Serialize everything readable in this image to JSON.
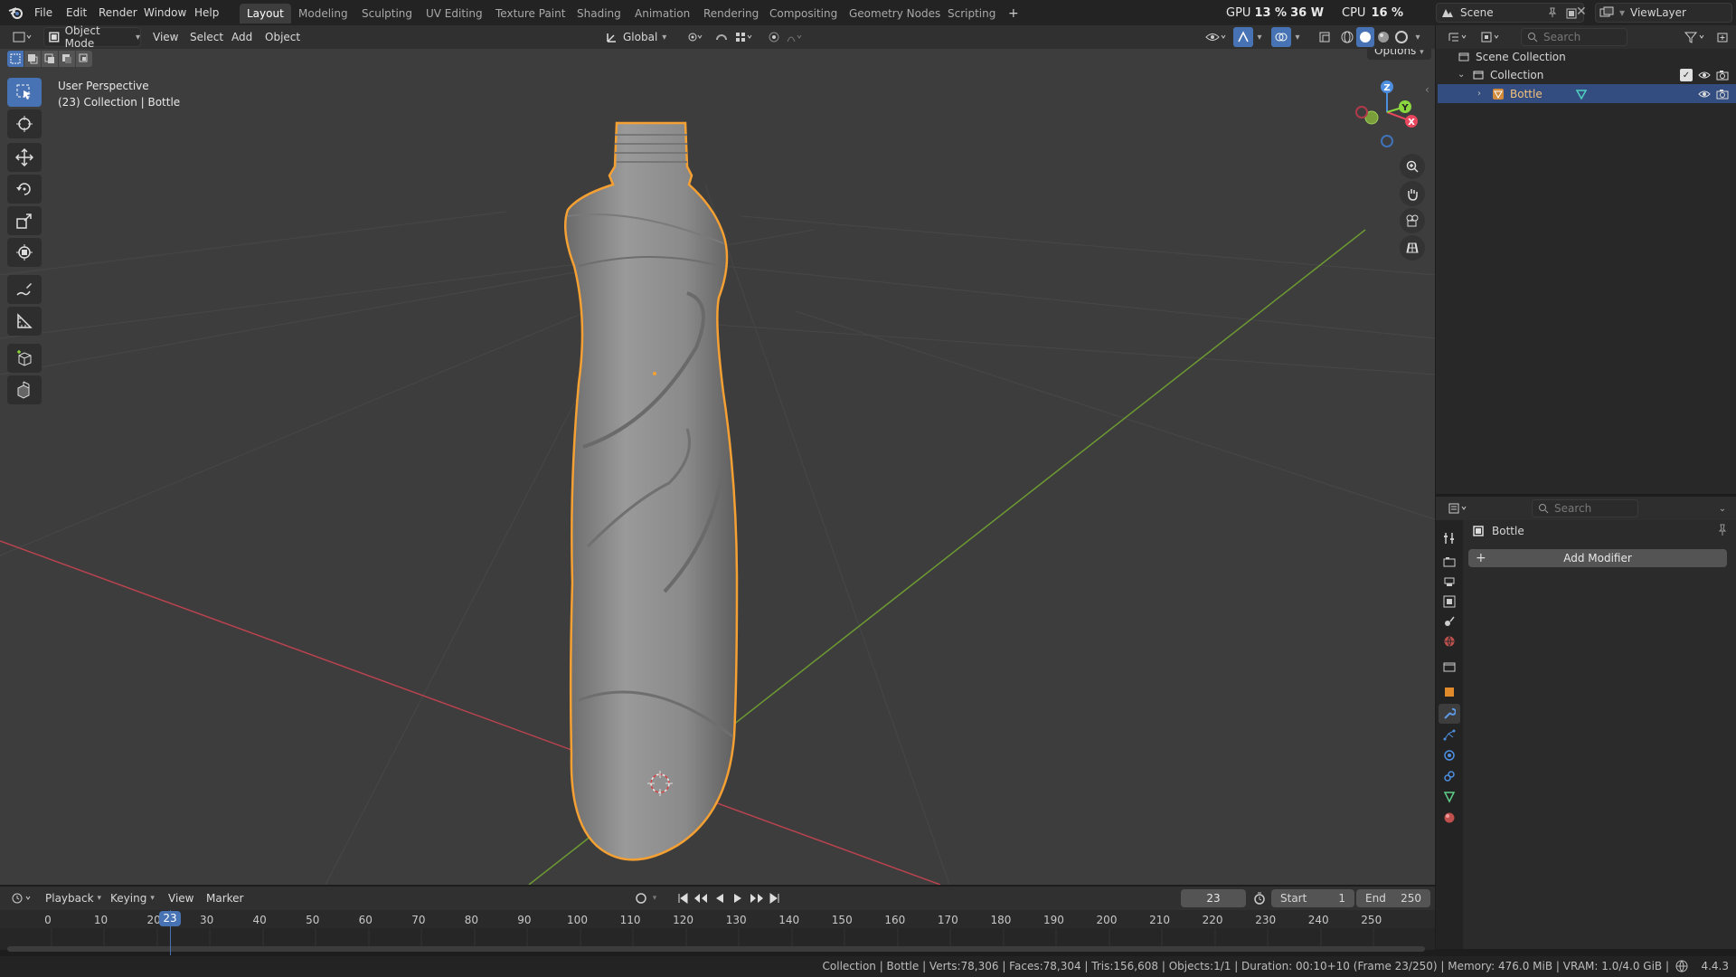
{
  "menu": [
    "File",
    "Edit",
    "Render",
    "Window",
    "Help"
  ],
  "workspaces": [
    "Layout",
    "Modeling",
    "Sculpting",
    "UV Editing",
    "Texture Paint",
    "Shading",
    "Animation",
    "Rendering",
    "Compositing",
    "Geometry Nodes",
    "Scripting"
  ],
  "active_workspace": "Layout",
  "add_tab": "+",
  "perf": {
    "gpu_label": "GPU",
    "gpu_value": "13 %",
    "gpu_watts": "36 W",
    "cpu_label": "CPU",
    "cpu_value": "16 %"
  },
  "scene": {
    "scene_name": "Scene",
    "view_layer": "ViewLayer"
  },
  "viewport": {
    "mode": "Object Mode",
    "menus": [
      "View",
      "Select",
      "Add",
      "Object"
    ],
    "transform_orientation": "Global",
    "options_label": "Options",
    "overlay_title": "User Perspective",
    "overlay_subtitle": "(23) Collection | Bottle",
    "axis_x": "X",
    "axis_y": "Y",
    "axis_z": "Z"
  },
  "tools": [
    "select-box-icon",
    "cursor-icon",
    "move-icon",
    "rotate-icon",
    "scale-icon",
    "transform-icon",
    "annotate-icon",
    "measure-icon",
    "add-cube-icon",
    "extrude-icon"
  ],
  "outliner": {
    "search_placeholder": "Search",
    "scene_collection": "Scene Collection",
    "collection": "Collection",
    "object": "Bottle"
  },
  "properties": {
    "search_placeholder": "Search",
    "object_name": "Bottle",
    "add_modifier": "Add Modifier"
  },
  "timeline": {
    "menus": [
      "Playback",
      "Keying",
      "View",
      "Marker"
    ],
    "current_frame": "23",
    "start_label": "Start",
    "start_value": "1",
    "end_label": "End",
    "end_value": "250",
    "ticks": [
      "0",
      "10",
      "20",
      "30",
      "40",
      "50",
      "60",
      "70",
      "80",
      "90",
      "100",
      "110",
      "120",
      "130",
      "140",
      "150",
      "160",
      "170",
      "180",
      "190",
      "200",
      "210",
      "220",
      "230",
      "240",
      "250"
    ]
  },
  "status": {
    "text": "Collection | Bottle | Verts:78,306 | Faces:78,304 | Tris:156,608 | Objects:1/1 | Duration: 00:10+10 (Frame 23/250) | Memory: 476.0 MiB | VRAM: 1.0/4.0 GiB |",
    "version": "4.4.3"
  },
  "colors": {
    "accent": "#4772b3",
    "selection": "#f5a033",
    "x_axis": "#e8475e",
    "y_axis": "#8bd63e",
    "z_axis": "#4d8ee0"
  }
}
